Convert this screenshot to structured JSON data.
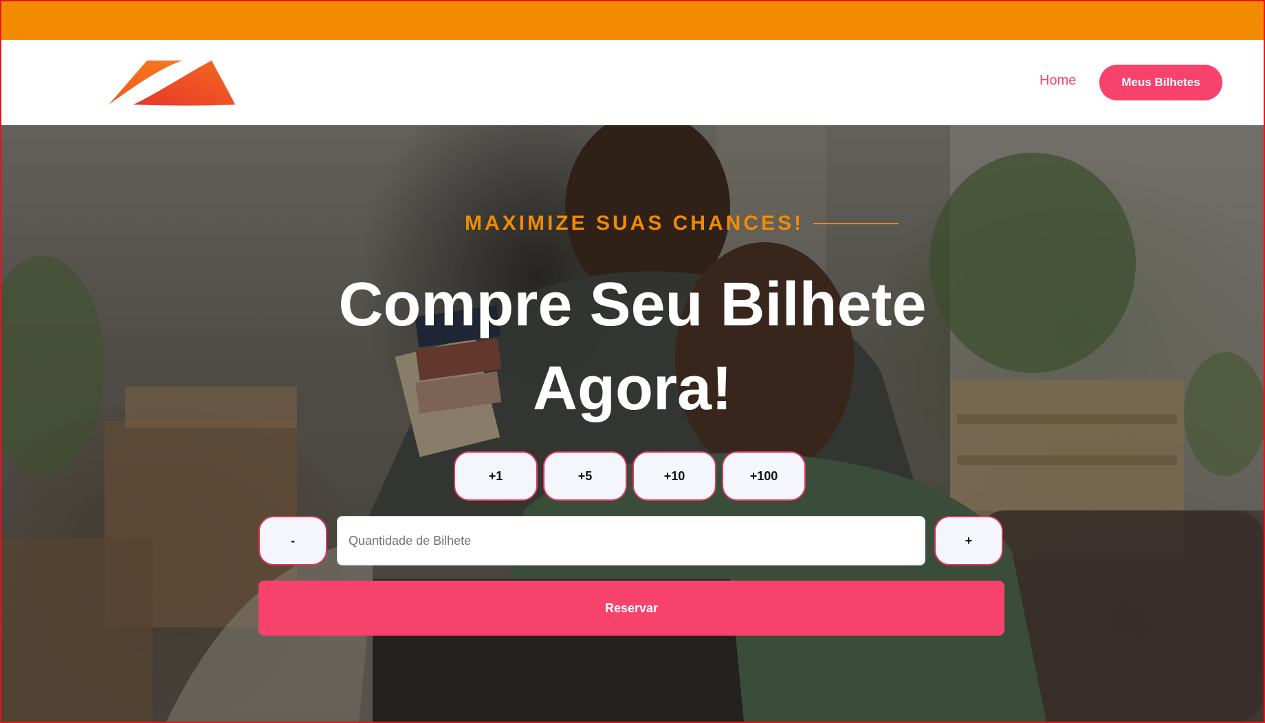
{
  "header": {
    "logo_icon": "brand-swoosh-logo",
    "nav_home": "Home",
    "nav_tickets": "Meus Bilhetes"
  },
  "hero": {
    "background_image": "couple-smiling-with-color-swatches",
    "eyebrow": "MAXIMIZE SUAS CHANCES!",
    "headline_line1": "Compre Seu Bilhete",
    "headline_line2": "Agora!",
    "quick_add": [
      "+1",
      "+5",
      "+10",
      "+100"
    ],
    "decrement_label": "-",
    "increment_label": "+",
    "quantity_placeholder": "Quantidade de Bilhete",
    "quantity_value": "",
    "reserve_label": "Reservar"
  },
  "colors": {
    "top_bar": "#f28b00",
    "accent": "#f7436c",
    "eyebrow": "#f28b00",
    "button_border": "#e0365c"
  }
}
